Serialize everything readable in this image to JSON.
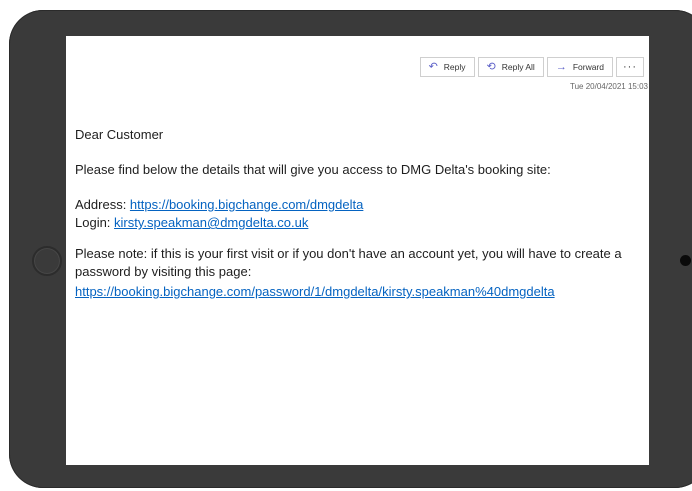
{
  "toolbar": {
    "reply_label": "Reply",
    "reply_all_label": "Reply All",
    "forward_label": "Forward",
    "more_label": "···"
  },
  "message": {
    "timestamp": "Tue 20/04/2021 15:03",
    "greeting": "Dear Customer",
    "intro": "Please find below the details that will give you access to DMG Delta's booking site:",
    "address_label": "Address: ",
    "address_link": "https://booking.bigchange.com/dmgdelta",
    "login_label": "Login: ",
    "login_link": "kirsty.speakman@dmgdelta.co.uk",
    "note": "Please note: if this is your first visit or if you don't have an account yet, you will have to create a password by visiting this page:",
    "password_link": "https://booking.bigchange.com/password/1/dmgdelta/kirsty.speakman%40dmgdelta"
  },
  "icons": {
    "reply": "reply-icon",
    "reply_all": "reply-all-icon",
    "forward": "forward-icon",
    "home_button": "home-button",
    "camera": "camera"
  },
  "colors": {
    "device_frame": "#3a3a3a",
    "link": "#0563c1",
    "icon_accent": "#5b5fc7"
  }
}
